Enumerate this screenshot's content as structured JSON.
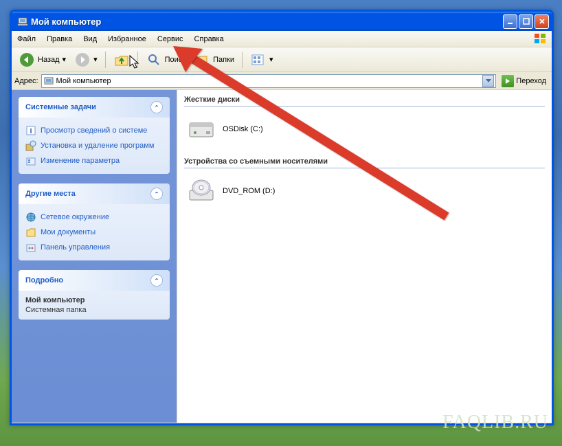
{
  "window": {
    "title": "Мой компьютер"
  },
  "menubar": [
    "Файл",
    "Правка",
    "Вид",
    "Избранное",
    "Сервис",
    "Справка"
  ],
  "toolbar": {
    "back_label": "Назад",
    "search_label": "Поиск",
    "folders_label": "Папки"
  },
  "addressbar": {
    "label": "Адрес:",
    "value": "Мой компьютер",
    "go_label": "Переход"
  },
  "sidebar": {
    "panels": [
      {
        "title": "Системные задачи",
        "links": [
          {
            "icon": "info-icon",
            "label": "Просмотр сведений о системе"
          },
          {
            "icon": "addremove-icon",
            "label": "Установка и удаление программ"
          },
          {
            "icon": "settings-icon",
            "label": "Изменение параметра"
          }
        ]
      },
      {
        "title": "Другие места",
        "links": [
          {
            "icon": "network-icon",
            "label": "Сетевое окружение"
          },
          {
            "icon": "documents-icon",
            "label": "Мои документы"
          },
          {
            "icon": "controlpanel-icon",
            "label": "Панель управления"
          }
        ]
      }
    ],
    "details": {
      "title": "Подробно",
      "name": "Мой компьютер",
      "type": "Системная папка"
    }
  },
  "content": {
    "sections": [
      {
        "title": "Жесткие диски",
        "items": [
          {
            "icon": "hdd-icon",
            "label": "OSDisk (C:)"
          }
        ]
      },
      {
        "title": "Устройства со съемными носителями",
        "items": [
          {
            "icon": "dvd-icon",
            "label": "DVD_ROM (D:)"
          }
        ]
      }
    ]
  },
  "watermark": "FAQLIB.RU"
}
